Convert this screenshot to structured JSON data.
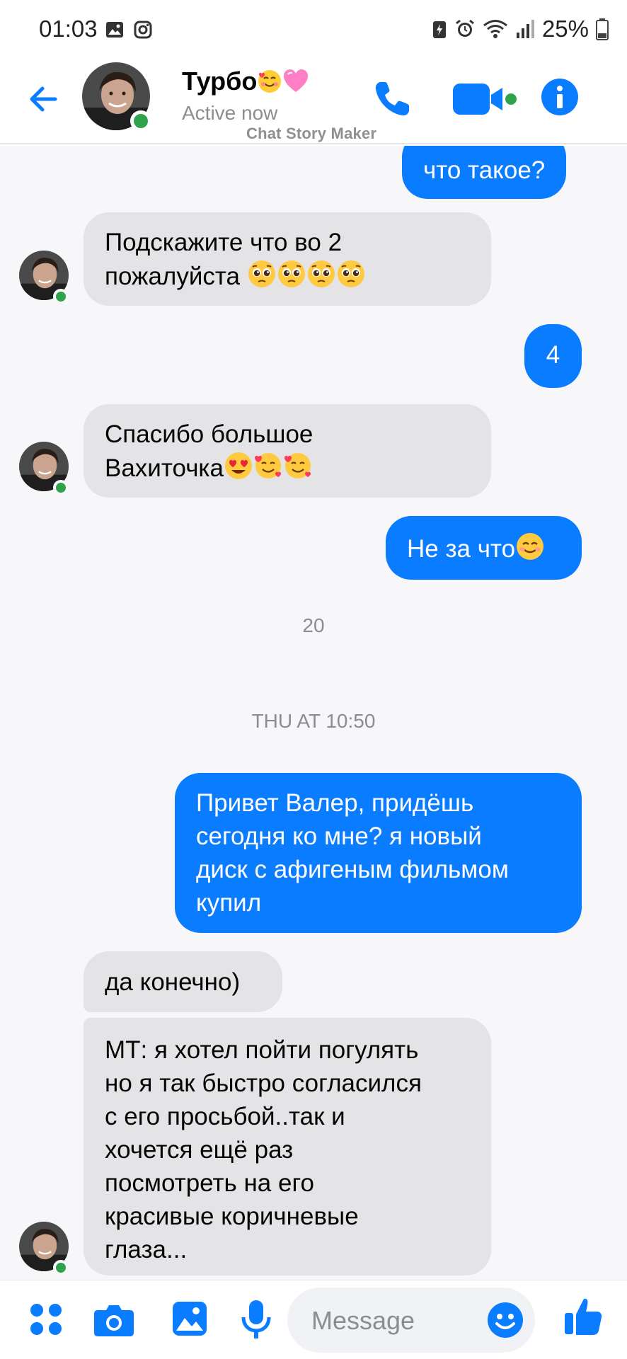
{
  "status_bar": {
    "time": "01:03",
    "battery": "25%"
  },
  "header": {
    "name": "Турбо",
    "status": "Active now",
    "watermark": "Chat Story Maker"
  },
  "messages": [
    {
      "side": "out",
      "text": "что такое?"
    },
    {
      "side": "in",
      "lines": [
        "Подскажите что во 2",
        "пожалуйста"
      ],
      "emoji": [
        "pleading-face",
        "pleading-face",
        "pleading-face",
        "pleading-face"
      ]
    },
    {
      "side": "out",
      "text": "4"
    },
    {
      "side": "in",
      "lines": [
        "Спасибо большое",
        "Вахиточка"
      ],
      "emoji": [
        "heart-eyes",
        "smiling-hearts",
        "smiling-hearts"
      ]
    },
    {
      "side": "out",
      "text": "Не за что",
      "emoji": [
        "smiling-blush"
      ]
    },
    {
      "side": "out",
      "lines": [
        "Привет Валер, придёшь",
        "сегодня ко мне? я новый",
        "диск с афигеным фильмом",
        "купил"
      ]
    },
    {
      "side": "in",
      "text": "да конечно)"
    },
    {
      "side": "in",
      "lines": [
        "МТ: я хотел пойти погулять",
        "но я так быстро согласился",
        "с его просьбой..так и",
        "хочется ещё раз",
        "посмотреть на его",
        "красивые коричневые",
        "глаза..."
      ]
    }
  ],
  "timestamps": {
    "first": "20",
    "second": "THU AT 10:50"
  },
  "composer": {
    "placeholder": "Message"
  },
  "colors": {
    "accent": "#0a7cff",
    "online": "#31a24c",
    "incoming_bubble": "#e4e4e7"
  }
}
